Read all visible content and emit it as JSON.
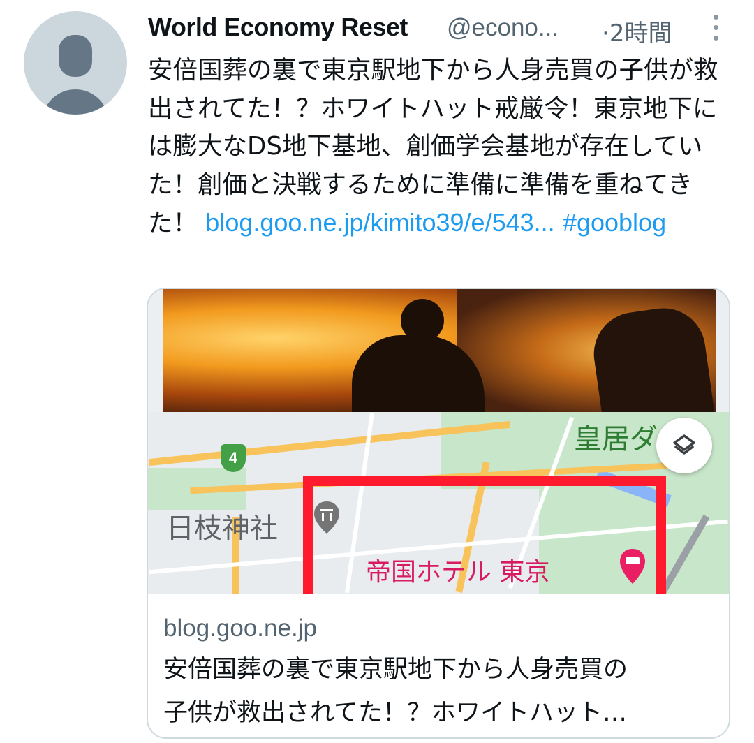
{
  "tweet": {
    "author_name": "World Economy Reset",
    "author_handle": "@econo...",
    "time_separator": "·",
    "time": "2時間",
    "text_body": "安倍国葬の裏で東京駅地下から人身売買の子供が救出されてた！？ホワイトハット戒厳令！東京地下には膨大なDS地下基地、創価学会基地が存在していた！創価と決戦するために準備に準備を重ねてきた！ ",
    "link_text": "blog.goo.ne.jp/kimito39/e/543...",
    "hashtag": "#gooblog",
    "link_color": "#1d9bf0"
  },
  "card": {
    "domain": "blog.goo.ne.jp",
    "title_line1": "安倍国葬の裏で東京駅地下から人身売買の",
    "title_line2": "子供が救出されてた！？ホワイトハット…",
    "map": {
      "label_palace": "皇居ダ",
      "label_shrine": "日枝神社",
      "label_hotel": "帝国ホテル 東京",
      "route_number": "4",
      "highlight_color": "#ff1a2e"
    }
  },
  "icons": {
    "more": "more-vertical-icon",
    "layers": "layers-icon",
    "hotel_pin": "hotel-pin-icon",
    "shrine_pin": "shrine-pin-icon",
    "avatar": "default-avatar-icon"
  }
}
